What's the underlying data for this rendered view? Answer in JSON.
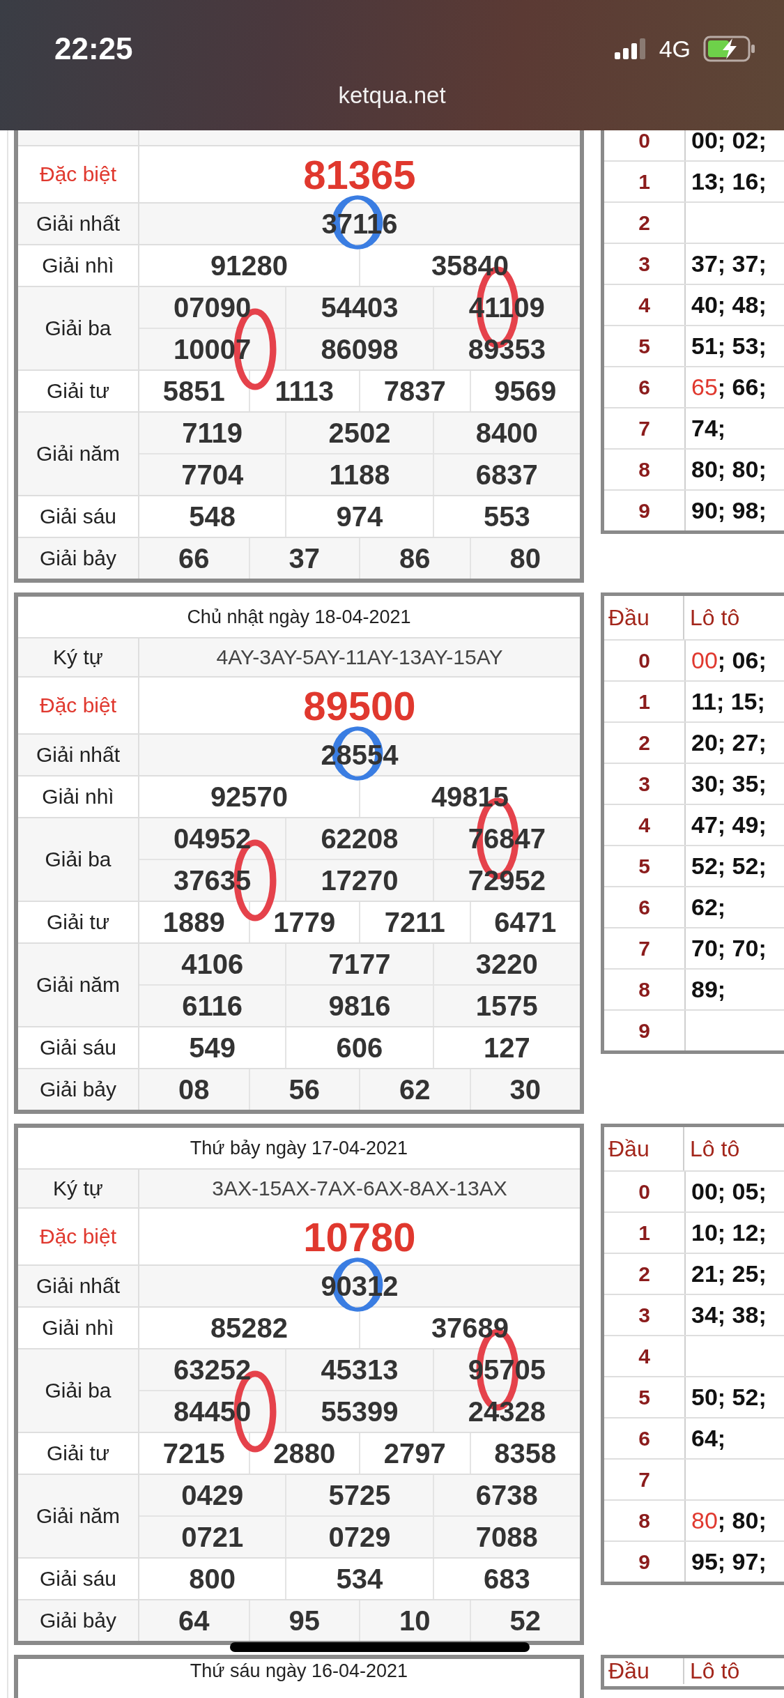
{
  "status_bar": {
    "time": "22:25",
    "network": "4G",
    "charging": true
  },
  "address_bar": {
    "url": "ketqua.net"
  },
  "days": [
    {
      "prizes": [
        {
          "label": "Đặc biệt",
          "kind": "special",
          "numbers": [
            "81365"
          ]
        },
        {
          "label": "Giải nhất",
          "kind": "regular",
          "numbers": [
            {
              "text": "37116",
              "color": "#3a7de2"
            }
          ]
        },
        {
          "label": "Giải nhì",
          "kind": "regular",
          "numbers": [
            "91280",
            "35840"
          ]
        },
        {
          "label": "Giải ba",
          "kind": "regular",
          "numbers": [
            "07090",
            "54403",
            {
              "text": "41109",
              "color": "#e5424b"
            },
            {
              "text": "10007",
              "color": "#e5424b"
            },
            "86098",
            "89353"
          ]
        },
        {
          "label": "Giải tư",
          "kind": "regular",
          "numbers": [
            "5851",
            "1113",
            "7837",
            "9569"
          ]
        },
        {
          "label": "Giải năm",
          "kind": "regular",
          "numbers": [
            "7119",
            "2502",
            "8400",
            "7704",
            "1188",
            "6837"
          ]
        },
        {
          "label": "Giải sáu",
          "kind": "regular",
          "numbers": [
            "548",
            "974",
            "553"
          ]
        },
        {
          "label": "Giải bảy",
          "kind": "regular",
          "numbers": [
            "66",
            "37",
            "86",
            "80"
          ]
        }
      ],
      "lotto": [
        {
          "head": "0",
          "parts": [
            {
              "text": "00; 02;",
              "special": false
            }
          ]
        },
        {
          "head": "1",
          "parts": [
            {
              "text": "13; 16;",
              "special": false
            }
          ]
        },
        {
          "head": "2"
        },
        {
          "head": "3",
          "parts": [
            {
              "text": "37; 37;",
              "special": false
            }
          ]
        },
        {
          "head": "4",
          "parts": [
            {
              "text": "40; 48;",
              "special": false
            }
          ]
        },
        {
          "head": "5",
          "parts": [
            {
              "text": "51; 53;",
              "special": false
            }
          ]
        },
        {
          "head": "6",
          "parts": [
            {
              "text": "65",
              "special": true
            },
            {
              "text": "; 66;",
              "special": false
            }
          ]
        },
        {
          "head": "7",
          "parts": [
            {
              "text": "74;",
              "special": false
            }
          ]
        },
        {
          "head": "8",
          "parts": [
            {
              "text": "80; 80;",
              "special": false
            }
          ]
        },
        {
          "head": "9",
          "parts": [
            {
              "text": "90; 98;",
              "special": false
            }
          ]
        }
      ]
    },
    {
      "title": "Chủ nhật ngày 18-04-2021",
      "code_label": "Ký tự",
      "code": "4AY-3AY-5AY-11AY-13AY-15AY",
      "prizes": [
        {
          "label": "Đặc biệt",
          "kind": "special",
          "numbers": [
            "89500"
          ]
        },
        {
          "label": "Giải nhất",
          "kind": "regular",
          "numbers": [
            {
              "text": "28554",
              "color": "#3a7de2"
            }
          ]
        },
        {
          "label": "Giải nhì",
          "kind": "regular",
          "numbers": [
            "92570",
            "49815"
          ]
        },
        {
          "label": "Giải ba",
          "kind": "regular",
          "numbers": [
            "04952",
            "62208",
            {
              "text": "76847",
              "color": "#e5424b"
            },
            {
              "text": "37635",
              "color": "#e5424b"
            },
            "17270",
            "72952"
          ]
        },
        {
          "label": "Giải tư",
          "kind": "regular",
          "numbers": [
            "1889",
            "1779",
            "7211",
            "6471"
          ]
        },
        {
          "label": "Giải năm",
          "kind": "regular",
          "numbers": [
            "4106",
            "7177",
            "3220",
            "6116",
            "9816",
            "1575"
          ]
        },
        {
          "label": "Giải sáu",
          "kind": "regular",
          "numbers": [
            "549",
            "606",
            "127"
          ]
        },
        {
          "label": "Giải bảy",
          "kind": "regular",
          "numbers": [
            "08",
            "56",
            "62",
            "30"
          ]
        }
      ],
      "lotto_header": {
        "head": "Đầu",
        "numbers": "Lô tô"
      },
      "lotto": [
        {
          "head": "0",
          "parts": [
            {
              "text": "00",
              "special": true
            },
            {
              "text": "; 06;",
              "special": false
            }
          ]
        },
        {
          "head": "1",
          "parts": [
            {
              "text": "11; 15;",
              "special": false
            }
          ]
        },
        {
          "head": "2",
          "parts": [
            {
              "text": "20; 27;",
              "special": false
            }
          ]
        },
        {
          "head": "3",
          "parts": [
            {
              "text": "30; 35;",
              "special": false
            }
          ]
        },
        {
          "head": "4",
          "parts": [
            {
              "text": "47; 49;",
              "special": false
            }
          ]
        },
        {
          "head": "5",
          "parts": [
            {
              "text": "52; 52;",
              "special": false
            }
          ]
        },
        {
          "head": "6",
          "parts": [
            {
              "text": "62;",
              "special": false
            }
          ]
        },
        {
          "head": "7",
          "parts": [
            {
              "text": "70; 70;",
              "special": false
            }
          ]
        },
        {
          "head": "8",
          "parts": [
            {
              "text": "89;",
              "special": false
            }
          ]
        },
        {
          "head": "9"
        }
      ]
    },
    {
      "title": "Thứ bảy ngày 17-04-2021",
      "code_label": "Ký tự",
      "code": "3AX-15AX-7AX-6AX-8AX-13AX",
      "prizes": [
        {
          "label": "Đặc biệt",
          "kind": "special",
          "numbers": [
            "10780"
          ]
        },
        {
          "label": "Giải nhất",
          "kind": "regular",
          "numbers": [
            {
              "text": "90312",
              "color": "#3a7de2"
            }
          ]
        },
        {
          "label": "Giải nhì",
          "kind": "regular",
          "numbers": [
            "85282",
            "37689"
          ]
        },
        {
          "label": "Giải ba",
          "kind": "regular",
          "numbers": [
            "63252",
            "45313",
            {
              "text": "95705",
              "color": "#e5424b"
            },
            {
              "text": "84450",
              "color": "#e5424b"
            },
            "55399",
            "24328"
          ]
        },
        {
          "label": "Giải tư",
          "kind": "regular",
          "numbers": [
            "7215",
            "2880",
            "2797",
            "8358"
          ]
        },
        {
          "label": "Giải năm",
          "kind": "regular",
          "numbers": [
            "0429",
            "5725",
            "6738",
            "0721",
            "0729",
            "7088"
          ]
        },
        {
          "label": "Giải sáu",
          "kind": "regular",
          "numbers": [
            "800",
            "534",
            "683"
          ]
        },
        {
          "label": "Giải bảy",
          "kind": "regular",
          "numbers": [
            "64",
            "95",
            "10",
            "52"
          ]
        }
      ],
      "lotto_header": {
        "head": "Đầu",
        "numbers": "Lô tô"
      },
      "lotto": [
        {
          "head": "0",
          "parts": [
            {
              "text": "00; 05;",
              "special": false
            }
          ]
        },
        {
          "head": "1",
          "parts": [
            {
              "text": "10; 12;",
              "special": false
            }
          ]
        },
        {
          "head": "2",
          "parts": [
            {
              "text": "21; 25;",
              "special": false
            }
          ]
        },
        {
          "head": "3",
          "parts": [
            {
              "text": "34; 38;",
              "special": false
            }
          ]
        },
        {
          "head": "4"
        },
        {
          "head": "5",
          "parts": [
            {
              "text": "50; 52;",
              "special": false
            }
          ]
        },
        {
          "head": "6",
          "parts": [
            {
              "text": "64;",
              "special": false
            }
          ]
        },
        {
          "head": "7"
        },
        {
          "head": "8",
          "parts": [
            {
              "text": "80",
              "special": true
            },
            {
              "text": "; 80;",
              "special": false
            }
          ]
        },
        {
          "head": "9",
          "parts": [
            {
              "text": "95; 97;",
              "special": false
            }
          ]
        }
      ]
    },
    {
      "title": "Thứ sáu ngày 16-04-2021",
      "lotto_header": {
        "head": "Đầu",
        "numbers": "Lô tô"
      }
    }
  ]
}
